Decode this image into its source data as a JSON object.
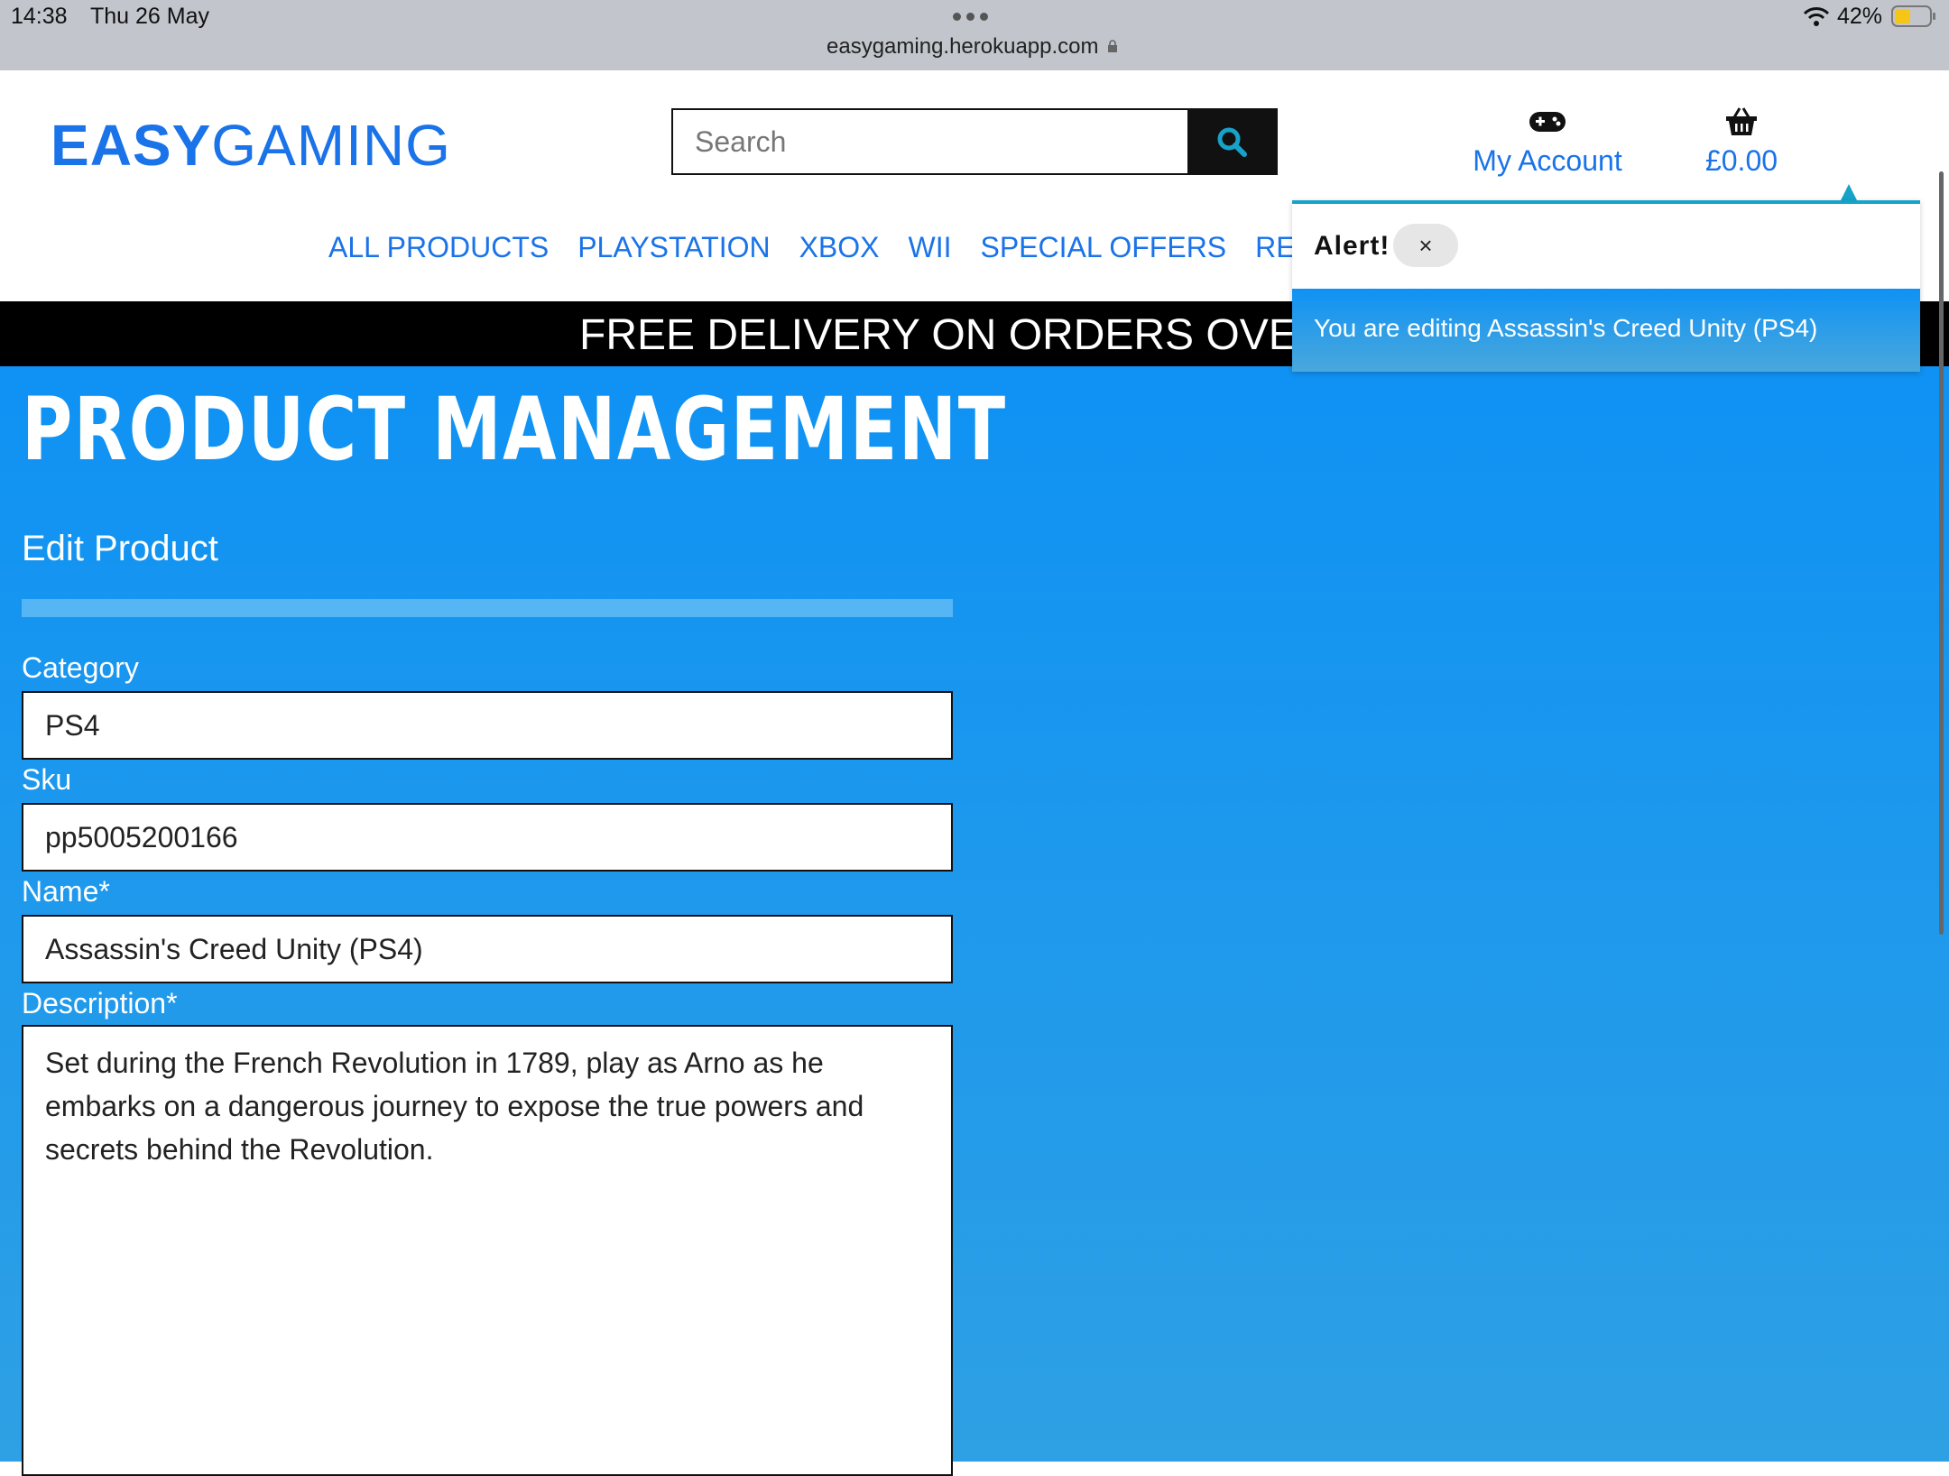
{
  "status_bar": {
    "time": "14:38",
    "date": "Thu 26 May",
    "url": "easygaming.herokuapp.com",
    "battery": "42%"
  },
  "header": {
    "logo_bold": "EASY",
    "logo_rest": "GAMING",
    "search_placeholder": "Search",
    "account_label": "My Account",
    "basket_total": "£0.00",
    "nav": [
      "ALL PRODUCTS",
      "PLAYSTATION",
      "XBOX",
      "WII",
      "SPECIAL OFFERS",
      "REVIE"
    ]
  },
  "banner": {
    "text": "FREE DELIVERY ON ORDERS OVER £"
  },
  "main": {
    "title": "PRODUCT MANAGEMENT",
    "subtitle": "Edit Product",
    "fields": {
      "category": {
        "label": "Category",
        "value": "PS4"
      },
      "sku": {
        "label": "Sku",
        "value": "pp5005200166"
      },
      "name": {
        "label": "Name*",
        "value": "Assassin's Creed Unity (PS4)"
      },
      "description": {
        "label": "Description*",
        "value": "Set during the French Revolution in 1789, play as Arno as he embarks on a dangerous journey to expose the true powers and secrets behind the Revolution."
      }
    }
  },
  "toast": {
    "header": "Alert!",
    "close": "×",
    "message": "You are editing Assassin's Creed Unity (PS4)"
  },
  "colors": {
    "brand": "#1a73e8",
    "page_bg": "#0f92f4",
    "toast_accent": "#17a2c9"
  }
}
